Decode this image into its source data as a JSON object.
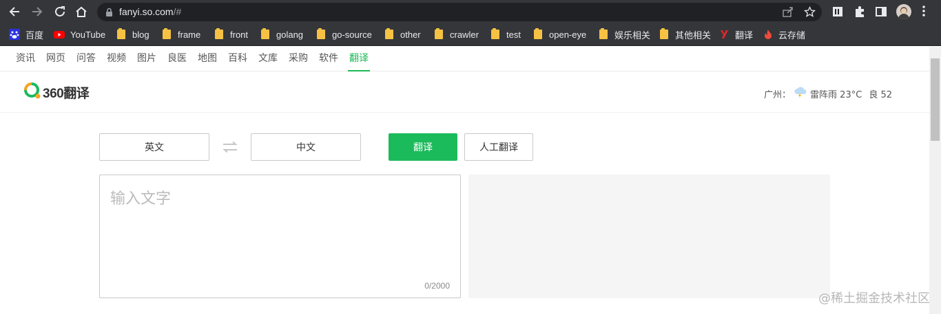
{
  "browser": {
    "url_host": "fanyi.so.com",
    "url_path": "/#",
    "icons": [
      "back-arrow-icon",
      "forward-arrow-icon",
      "reload-icon",
      "home-icon",
      "lock-icon",
      "share-icon",
      "star-icon",
      "extension-icon",
      "puzzle-icon",
      "sidebar-icon",
      "menu-icon"
    ]
  },
  "bookmarks": [
    {
      "label": "百度",
      "icon": "baidu-icon"
    },
    {
      "label": "YouTube",
      "icon": "youtube-icon"
    },
    {
      "label": "blog",
      "icon": "folder-icon"
    },
    {
      "label": "frame",
      "icon": "folder-icon"
    },
    {
      "label": "front",
      "icon": "folder-icon"
    },
    {
      "label": "golang",
      "icon": "folder-icon"
    },
    {
      "label": "go-source",
      "icon": "folder-icon"
    },
    {
      "label": "other",
      "icon": "folder-icon"
    },
    {
      "label": "crawler",
      "icon": "folder-icon"
    },
    {
      "label": "test",
      "icon": "folder-icon"
    },
    {
      "label": "open-eye",
      "icon": "folder-icon"
    },
    {
      "label": "娱乐相关",
      "icon": "folder-icon"
    },
    {
      "label": "其他相关",
      "icon": "folder-icon"
    },
    {
      "label": "翻译",
      "icon": "youdao-icon"
    },
    {
      "label": "云存储",
      "icon": "flame-icon"
    }
  ],
  "topnav": [
    "资讯",
    "网页",
    "问答",
    "视频",
    "图片",
    "良医",
    "地图",
    "百科",
    "文库",
    "采购",
    "软件",
    "翻译"
  ],
  "header": {
    "logo_text": "360翻译",
    "city": "广州：",
    "weather": "雷阵雨 23°C",
    "air": "良 52"
  },
  "translator": {
    "source_lang": "英文",
    "target_lang": "中文",
    "translate_label": "翻译",
    "human_label": "人工翻译",
    "placeholder": "输入文字",
    "char_count": "0/2000"
  },
  "watermark": "@稀土掘金技术社区",
  "colors": {
    "accent": "#1bba5b",
    "chrome_bg": "#35363a",
    "omnibox_bg": "#202124"
  }
}
